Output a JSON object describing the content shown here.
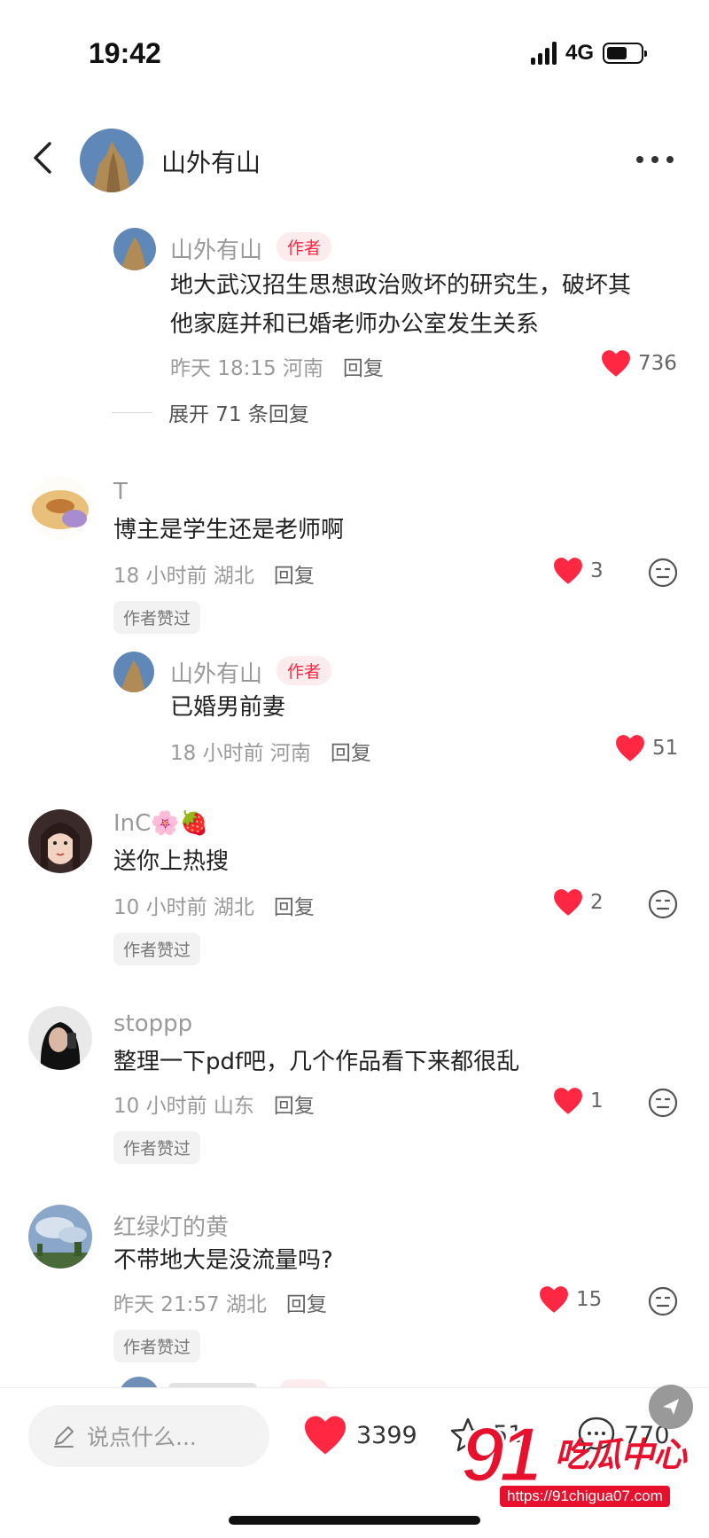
{
  "status_bar": {
    "time": "19:42",
    "network": "4G"
  },
  "header": {
    "title": "山外有山"
  },
  "comments": [
    {
      "username": "山外有山",
      "author_tag": "作者",
      "content_lines": [
        "地大武汉招生思想政治败坏的研究生，破坏其",
        "他家庭并和已婚老师办公室发生关系"
      ],
      "time": "昨天 18:15 河南",
      "reply_label": "回复",
      "likes": "736",
      "expand_label": "展开 71 条回复"
    },
    {
      "username": "T",
      "content": "博主是学生还是老师啊",
      "time": "18 小时前 湖北",
      "reply_label": "回复",
      "likes": "3",
      "author_liked": "作者赞过",
      "reply": {
        "username": "山外有山",
        "author_tag": "作者",
        "content": "已婚男前妻",
        "time": "18 小时前 河南",
        "reply_label": "回复",
        "likes": "51"
      }
    },
    {
      "username": "InC🌸🍓",
      "content": "送你上热搜",
      "time": "10 小时前 湖北",
      "reply_label": "回复",
      "likes": "2",
      "author_liked": "作者赞过"
    },
    {
      "username": "stoppp",
      "content": "整理一下pdf吧，几个作品看下来都很乱",
      "time": "10 小时前 山东",
      "reply_label": "回复",
      "likes": "1",
      "author_liked": "作者赞过"
    },
    {
      "username": "红绿灯的黄",
      "content": "不带地大是没流量吗?",
      "time": "昨天 21:57 湖北",
      "reply_label": "回复",
      "likes": "15",
      "author_liked": "作者赞过"
    }
  ],
  "bottom_bar": {
    "input_placeholder": "说点什么...",
    "likes": "3399",
    "stars": "51",
    "comments": "770"
  },
  "watermark": {
    "big": "91",
    "text": "吃瓜中心",
    "url": "https://91chigua07.com"
  },
  "colors": {
    "accent": "#ff2741",
    "text": "#222222",
    "meta": "#9a9a9a"
  }
}
